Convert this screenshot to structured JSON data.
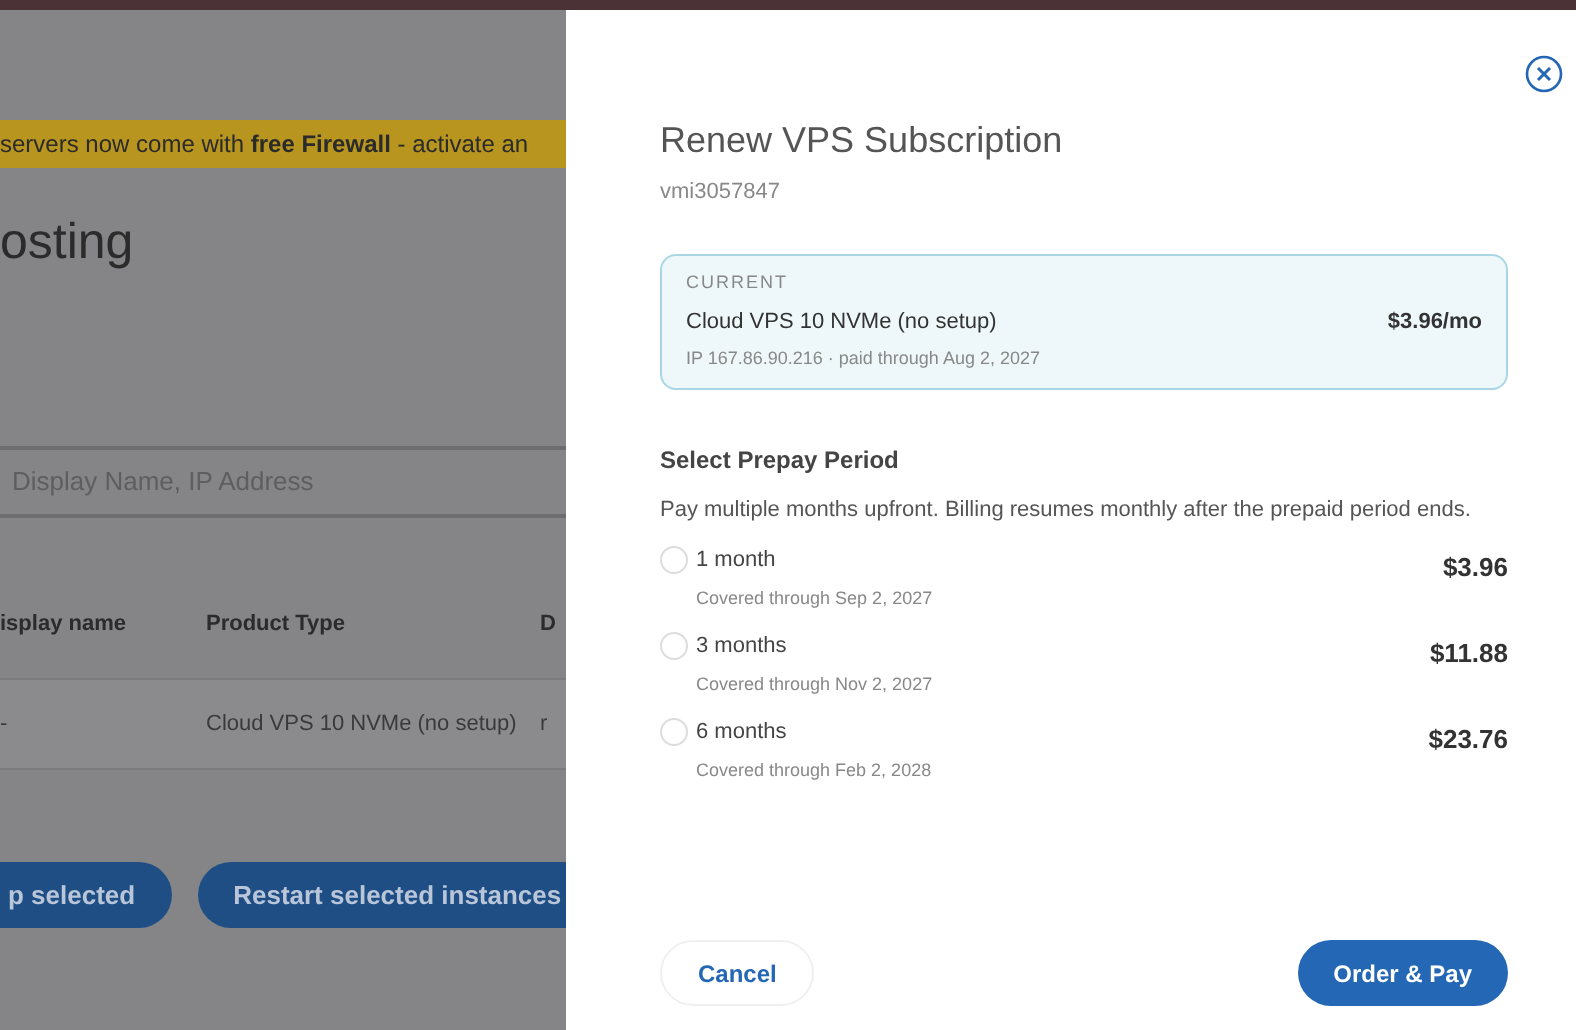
{
  "background_page": {
    "banner": "servers now come with **free Firewall** - activate an",
    "heading": "osting",
    "search": {
      "placeholder": "Display Name, IP Address"
    },
    "table": {
      "columns": [
        "isplay name",
        "Product Type",
        "D"
      ],
      "rows": [
        [
          "-",
          "Cloud VPS 10 NVMe (no setup)",
          "r"
        ]
      ]
    },
    "buttons": [
      "p selected",
      "Restart selected instances"
    ]
  },
  "drawer": {
    "title": "Renew VPS Subscription",
    "subtitle": "vmi3057847",
    "current": {
      "label": "CURRENT",
      "product": "Cloud VPS 10 NVMe (no setup)",
      "price": "$3.96/mo",
      "details": "IP 167.86.90.216 · paid through Aug 2, 2027"
    },
    "section_title": "Select Prepay Period",
    "section_description": "Pay multiple months upfront. Billing resumes monthly after the prepaid period ends.",
    "periods": [
      {
        "label": "1 month",
        "covered": "Covered through Sep 2, 2027",
        "price": "$3.96",
        "selected": false
      },
      {
        "label": "3 months",
        "covered": "Covered through Nov 2, 2027",
        "price": "$11.88",
        "selected": false
      },
      {
        "label": "6 months",
        "covered": "Covered through Feb 2, 2028",
        "price": "$23.76",
        "selected": false
      }
    ],
    "cancel_button": "Cancel",
    "submit_button": "Order & Pay"
  }
}
